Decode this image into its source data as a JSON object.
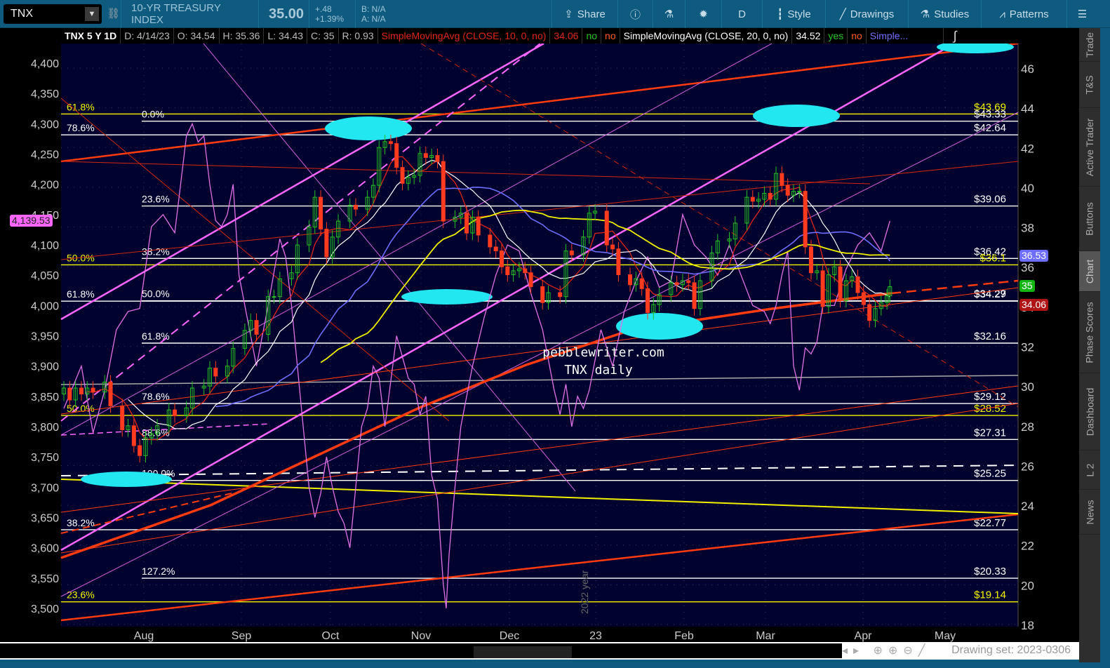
{
  "toolbar": {
    "symbol": "TNX",
    "description": "10-YR TREASURY INDEX",
    "last": "35.00",
    "change": "+.48",
    "change_pct": "+1.39%",
    "bid": "B: N/A",
    "ask": "A: N/A",
    "buttons": {
      "share": "Share",
      "period": "D",
      "style": "Style",
      "drawings": "Drawings",
      "studies": "Studies",
      "patterns": "Patterns"
    }
  },
  "infobar": {
    "title": "TNX 5 Y 1D",
    "date": "D: 4/14/23",
    "open": "O: 34.54",
    "high": "H: 35.36",
    "low": "L: 34.43",
    "close": "C: 35",
    "range": "R: 0.93",
    "sma1": "SimpleMovingAvg (CLOSE, 10, 0, no)",
    "sma1_val": "34.06",
    "sma1_a": "no",
    "sma1_b": "no",
    "sma2": "SimpleMovingAvg (CLOSE, 20, 0, no)",
    "sma2_val": "34.52",
    "sma2_a": "yes",
    "sma2_b": "no",
    "sma3": "Simple..."
  },
  "sidebar": [
    "Trade",
    "T&S",
    "Active Trader",
    "Buttons",
    "Chart",
    "Phase Scores",
    "Dashboard",
    "L 2",
    "News"
  ],
  "sidebar_active": "Chart",
  "bottom": {
    "drawing_set": "Drawing set: 2023-0306"
  },
  "watermark": {
    "line1": "pebblewriter.com",
    "line2": "TNX daily",
    "year": "2022 year"
  },
  "tags": {
    "spx": "4,139.53",
    "blue": "36.53",
    "green": "35",
    "red": "34.06"
  },
  "colors": {
    "bg": "#02022e",
    "candle_up": "#22c322",
    "candle_down": "#ff3b1f",
    "sma10": "#e0261a",
    "sma20": "#ffffff",
    "sma50": "#6d6dff",
    "sma100": "#f0f000",
    "spx": "#e070e8",
    "fib_white": "#ffffff",
    "fib_yellow": "#f5f500"
  },
  "chart_data": {
    "type": "candlestick",
    "x_labels": [
      "Aug",
      "Sep",
      "Oct",
      "Nov",
      "Dec",
      "23",
      "Feb",
      "Mar",
      "Apr",
      "May"
    ],
    "right_axis": {
      "ticks": [
        18,
        20,
        22,
        24,
        26,
        28,
        30,
        32,
        34,
        36,
        38,
        40,
        42,
        44,
        46
      ],
      "range": [
        18,
        46
      ]
    },
    "left_axis": {
      "ticks": [
        "3,500",
        "3,550",
        "3,600",
        "3,650",
        "3,700",
        "3,750",
        "3,800",
        "3,850",
        "3,900",
        "3,950",
        "4,000",
        "4,050",
        "4,100",
        "4,150",
        "4,200",
        "4,250",
        "4,300",
        "4,350",
        "4,400"
      ],
      "range": [
        3500,
        4400
      ]
    },
    "tnx_closes": [
      [
        0,
        29.9
      ],
      [
        2,
        29.3
      ],
      [
        4,
        29.9
      ],
      [
        6,
        29.6
      ],
      [
        8,
        29.9
      ],
      [
        10,
        29.7
      ],
      [
        14,
        30.2
      ],
      [
        16,
        29.0
      ],
      [
        20,
        27.8
      ],
      [
        22,
        28.0
      ],
      [
        24,
        27.0
      ],
      [
        26,
        26.5
      ],
      [
        28,
        27.4
      ],
      [
        30,
        27.6
      ],
      [
        32,
        28.0
      ],
      [
        36,
        28.8
      ],
      [
        38,
        28.5
      ],
      [
        42,
        28.9
      ],
      [
        44,
        29.9
      ],
      [
        48,
        30.0
      ],
      [
        50,
        30.9
      ],
      [
        52,
        30.5
      ],
      [
        56,
        31.0
      ],
      [
        58,
        31.9
      ],
      [
        62,
        32.8
      ],
      [
        64,
        33.3
      ],
      [
        66,
        32.6
      ],
      [
        70,
        34.5
      ],
      [
        72,
        34.5
      ],
      [
        74,
        35.4
      ],
      [
        78,
        35.7
      ],
      [
        80,
        37.1
      ],
      [
        84,
        38.0
      ],
      [
        86,
        39.5
      ],
      [
        88,
        37.9
      ],
      [
        90,
        36.5
      ],
      [
        92,
        37.5
      ],
      [
        94,
        38.3
      ],
      [
        98,
        39.1
      ],
      [
        100,
        38.9
      ],
      [
        104,
        39.5
      ],
      [
        106,
        40.1
      ],
      [
        108,
        42.0
      ],
      [
        110,
        42.3
      ],
      [
        112,
        42.2
      ],
      [
        114,
        41.0
      ],
      [
        116,
        40.2
      ],
      [
        118,
        40.5
      ],
      [
        120,
        40.6
      ],
      [
        122,
        41.7
      ],
      [
        124,
        41.5
      ],
      [
        126,
        41.6
      ],
      [
        128,
        41.3
      ],
      [
        130,
        38.3
      ],
      [
        134,
        38.5
      ],
      [
        136,
        38.7
      ],
      [
        138,
        37.7
      ],
      [
        140,
        38.5
      ],
      [
        142,
        37.6
      ],
      [
        146,
        37.0
      ],
      [
        148,
        36.8
      ],
      [
        150,
        36.0
      ],
      [
        152,
        35.6
      ],
      [
        154,
        35.8
      ],
      [
        156,
        35.9
      ],
      [
        158,
        35.7
      ],
      [
        160,
        35.0
      ],
      [
        164,
        34.2
      ],
      [
        166,
        34.7
      ],
      [
        170,
        34.5
      ],
      [
        172,
        36.8
      ],
      [
        174,
        36.6
      ],
      [
        178,
        37.5
      ],
      [
        180,
        38.7
      ],
      [
        182,
        38.8
      ],
      [
        186,
        37.1
      ],
      [
        188,
        36.9
      ],
      [
        190,
        35.6
      ],
      [
        194,
        35.1
      ],
      [
        196,
        35.4
      ],
      [
        198,
        34.9
      ],
      [
        200,
        33.7
      ],
      [
        202,
        34.1
      ],
      [
        204,
        34.6
      ],
      [
        208,
        35.2
      ],
      [
        210,
        35.1
      ],
      [
        212,
        35.3
      ],
      [
        214,
        35.2
      ],
      [
        216,
        33.9
      ],
      [
        218,
        35.3
      ],
      [
        222,
        36.7
      ],
      [
        224,
        37.3
      ],
      [
        228,
        37.4
      ],
      [
        230,
        38.2
      ],
      [
        234,
        39.5
      ],
      [
        236,
        39.3
      ],
      [
        238,
        39.4
      ],
      [
        240,
        39.7
      ],
      [
        242,
        39.4
      ],
      [
        244,
        40.7
      ],
      [
        246,
        40.1
      ],
      [
        248,
        39.6
      ],
      [
        250,
        39.8
      ],
      [
        252,
        39.8
      ],
      [
        254,
        37.0
      ],
      [
        256,
        35.7
      ],
      [
        258,
        35.8
      ],
      [
        260,
        34.0
      ],
      [
        262,
        35.6
      ],
      [
        264,
        36.0
      ],
      [
        266,
        34.3
      ],
      [
        268,
        35.3
      ],
      [
        270,
        35.5
      ],
      [
        272,
        34.7
      ],
      [
        274,
        34.1
      ],
      [
        276,
        33.3
      ],
      [
        278,
        33.9
      ],
      [
        280,
        34.2
      ],
      [
        282,
        34.54
      ],
      [
        283,
        35.0
      ]
    ],
    "spx_closes": [
      [
        0,
        3830
      ],
      [
        6,
        3900
      ],
      [
        10,
        3790
      ],
      [
        14,
        3860
      ],
      [
        18,
        3960
      ],
      [
        22,
        3990
      ],
      [
        26,
        3995
      ],
      [
        30,
        4130
      ],
      [
        34,
        4150
      ],
      [
        38,
        4120
      ],
      [
        42,
        4280
      ],
      [
        44,
        4300
      ],
      [
        46,
        4270
      ],
      [
        48,
        4280
      ],
      [
        50,
        4200
      ],
      [
        52,
        4140
      ],
      [
        54,
        4130
      ],
      [
        56,
        4150
      ],
      [
        58,
        4200
      ],
      [
        60,
        4050
      ],
      [
        64,
        3950
      ],
      [
        66,
        3900
      ],
      [
        68,
        3950
      ],
      [
        70,
        4000
      ],
      [
        74,
        4110
      ],
      [
        76,
        4080
      ],
      [
        78,
        4000
      ],
      [
        80,
        3900
      ],
      [
        82,
        3800
      ],
      [
        84,
        3700
      ],
      [
        86,
        3650
      ],
      [
        88,
        3690
      ],
      [
        90,
        3750
      ],
      [
        92,
        3700
      ],
      [
        94,
        3660
      ],
      [
        96,
        3640
      ],
      [
        98,
        3600
      ],
      [
        100,
        3700
      ],
      [
        102,
        3800
      ],
      [
        104,
        3830
      ],
      [
        106,
        3900
      ],
      [
        108,
        3880
      ],
      [
        110,
        3800
      ],
      [
        114,
        3950
      ],
      [
        118,
        3880
      ],
      [
        120,
        3870
      ],
      [
        122,
        3820
      ],
      [
        124,
        3850
      ],
      [
        126,
        3720
      ],
      [
        128,
        3680
      ],
      [
        130,
        3540
      ],
      [
        131,
        3500
      ],
      [
        132,
        3590
      ],
      [
        134,
        3700
      ],
      [
        136,
        3800
      ],
      [
        140,
        3900
      ],
      [
        144,
        3980
      ],
      [
        148,
        4050
      ],
      [
        152,
        4100
      ],
      [
        156,
        4090
      ],
      [
        160,
        4020
      ],
      [
        164,
        3960
      ],
      [
        168,
        3860
      ],
      [
        170,
        3820
      ],
      [
        172,
        3870
      ],
      [
        174,
        3800
      ],
      [
        176,
        3850
      ],
      [
        178,
        3830
      ],
      [
        180,
        3860
      ],
      [
        184,
        3960
      ],
      [
        188,
        3900
      ],
      [
        192,
        3990
      ],
      [
        196,
        4040
      ],
      [
        200,
        4080
      ],
      [
        204,
        4030
      ],
      [
        208,
        4040
      ],
      [
        212,
        4150
      ],
      [
        216,
        4100
      ],
      [
        220,
        4080
      ],
      [
        224,
        4050
      ],
      [
        228,
        4100
      ],
      [
        232,
        4050
      ],
      [
        236,
        4000
      ],
      [
        240,
        3990
      ],
      [
        242,
        3970
      ],
      [
        244,
        4000
      ],
      [
        246,
        4050
      ],
      [
        248,
        4090
      ],
      [
        250,
        3900
      ],
      [
        252,
        3860
      ],
      [
        254,
        3930
      ],
      [
        256,
        3920
      ],
      [
        258,
        3940
      ],
      [
        260,
        4000
      ],
      [
        264,
        4000
      ],
      [
        268,
        4060
      ],
      [
        272,
        4100
      ],
      [
        276,
        4120
      ],
      [
        280,
        4090
      ],
      [
        283,
        4139.53
      ]
    ],
    "fib_levels": [
      {
        "price": 43.69,
        "right": "$43.69",
        "left": "61.8%",
        "col": "a",
        "color": "yellow"
      },
      {
        "price": 43.33,
        "right": "$43.33",
        "left": "0.0%",
        "col": "b",
        "color": "white"
      },
      {
        "price": 42.64,
        "right": "$42.64",
        "left": "78.6%",
        "col": "a",
        "color": "white"
      },
      {
        "price": 39.06,
        "right": "$39.06",
        "left": "23.6%",
        "col": "b",
        "color": "white"
      },
      {
        "price": 36.42,
        "right": "$36.42",
        "left": "38.2%",
        "col": "b",
        "color": "white"
      },
      {
        "price": 36.1,
        "right": "$36.1",
        "left": "50.0%",
        "col": "a",
        "color": "yellow"
      },
      {
        "price": 34.27,
        "right": "$34.27",
        "left": "61.8%",
        "col": "a",
        "color": "white"
      },
      {
        "price": 34.29,
        "right": "$34.29",
        "left": "50.0%",
        "col": "b",
        "color": "white"
      },
      {
        "price": 32.16,
        "right": "$32.16",
        "left": "61.8%",
        "col": "b",
        "color": "white"
      },
      {
        "price": 29.12,
        "right": "$29.12",
        "left": "78.6%",
        "col": "b",
        "color": "white"
      },
      {
        "price": 28.52,
        "right": "$28.52",
        "left": "50.0%",
        "col": "a",
        "color": "yellow"
      },
      {
        "price": 27.31,
        "right": "$27.31",
        "left": "88.6%",
        "col": "b",
        "color": "white"
      },
      {
        "price": 25.25,
        "right": "$25.25",
        "left": "100.0%",
        "col": "b",
        "color": "white"
      },
      {
        "price": 22.77,
        "right": "$22.77",
        "left": "38.2%",
        "col": "a",
        "color": "white"
      },
      {
        "price": 20.33,
        "right": "$20.33",
        "left": "127.2%",
        "col": "b",
        "color": "white"
      },
      {
        "price": 19.14,
        "right": "$19.14",
        "left": "23.6%",
        "col": "a",
        "color": "yellow"
      }
    ]
  }
}
